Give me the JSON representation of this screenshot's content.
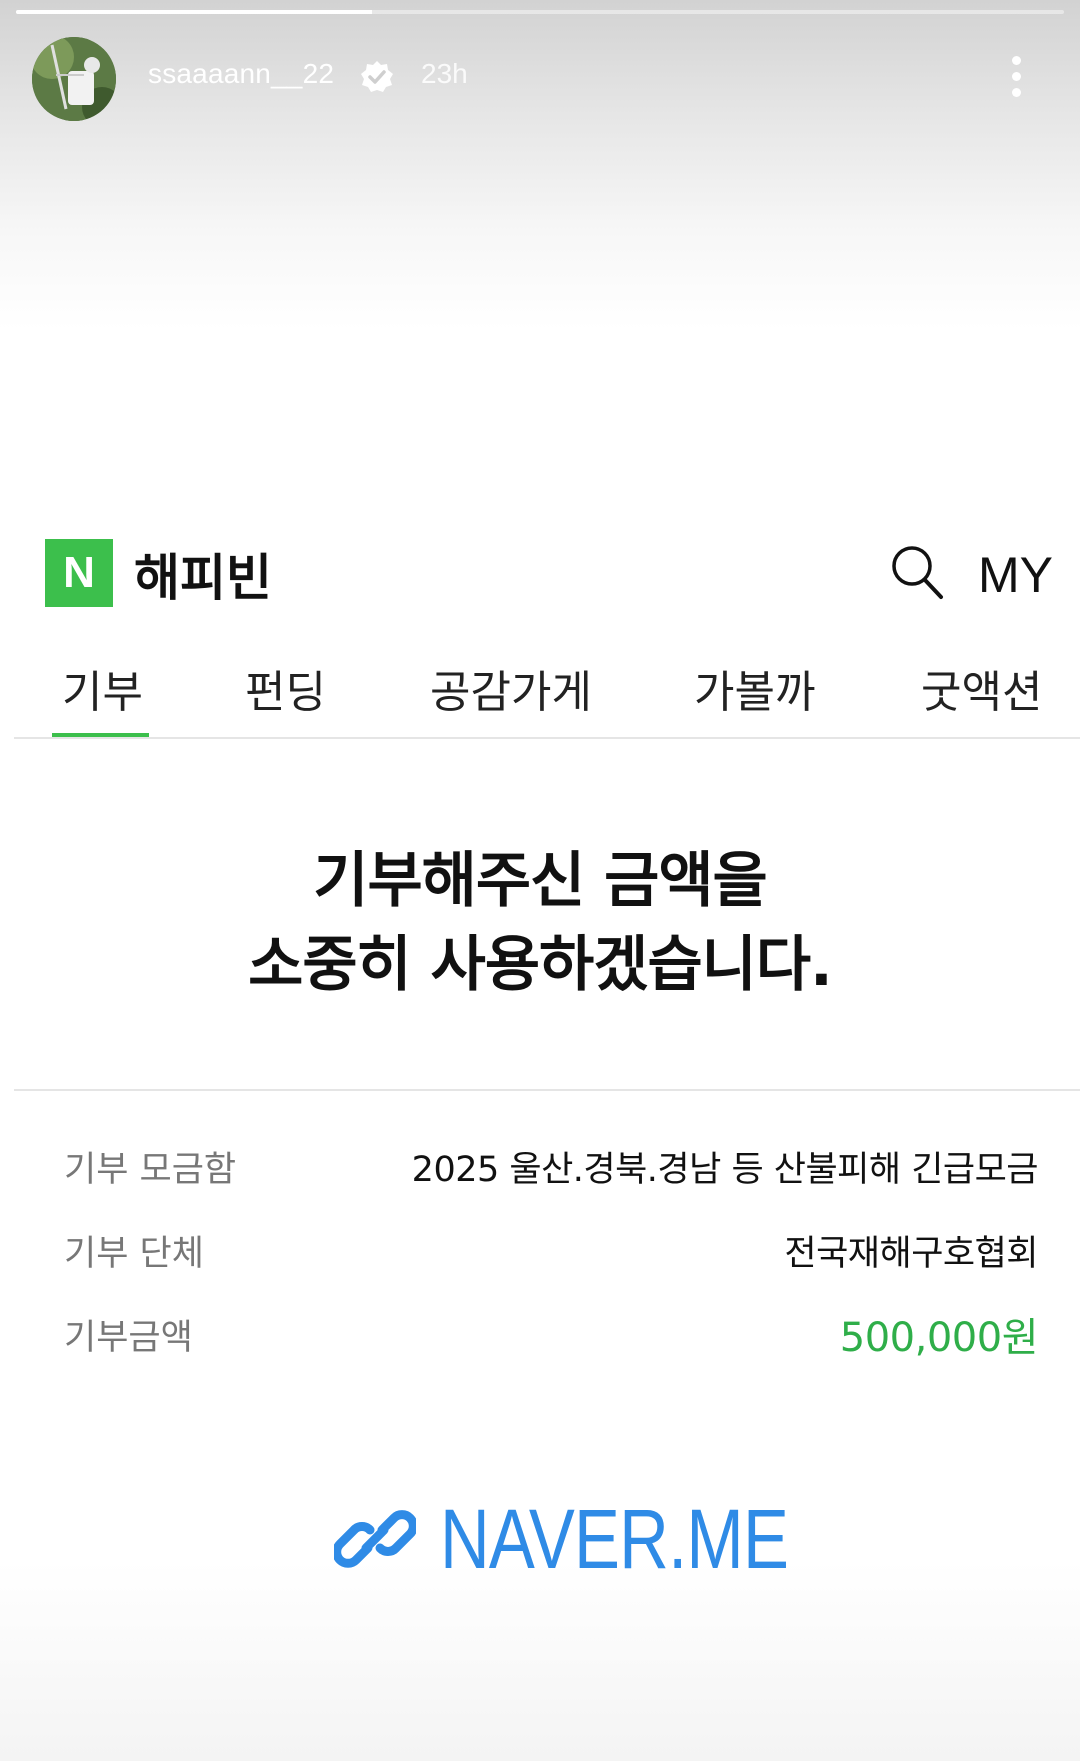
{
  "story": {
    "progress": 0.34,
    "username": "ssaaaann__22",
    "time_ago": "23h",
    "avatar_icon": "archer-avatar",
    "verified_icon": "verified-badge-icon",
    "more_icon": "more-vertical-icon"
  },
  "app": {
    "logo_letter": "N",
    "title": "해피빈",
    "search_icon": "search-icon",
    "my_label": "MY",
    "brand_color": "#3cbf4c"
  },
  "tabs": [
    {
      "label": "기부",
      "active": true
    },
    {
      "label": "펀딩",
      "active": false
    },
    {
      "label": "공감가게",
      "active": false
    },
    {
      "label": "가볼까",
      "active": false
    },
    {
      "label": "굿액션",
      "active": false
    }
  ],
  "message": {
    "line1": "기부해주신 금액을",
    "line2": "소중히 사용하겠습니다."
  },
  "details": [
    {
      "label": "기부 모금함",
      "value": "2025 울산.경북.경남 등 산불피해 긴급모금"
    },
    {
      "label": "기부 단체",
      "value": "전국재해구호협회"
    },
    {
      "label": "기부금액",
      "value": "500,000원"
    }
  ],
  "link_sticker": {
    "icon": "link-icon",
    "text": "NAVER.ME",
    "color": "#2f8be6"
  }
}
